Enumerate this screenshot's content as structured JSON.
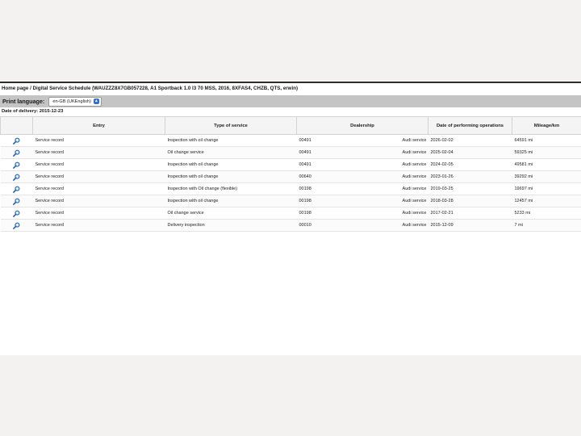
{
  "breadcrumb": {
    "home": "Home page",
    "sep": " / ",
    "current": "Digital Service Schedule (WAUZZZ8X7GB057228, A1 Sportback 1.0 l3 70 MSS, 2016, 8XFAS4, CHZB, QTS, erwin)"
  },
  "print": {
    "label": "Print language:",
    "selected": "en-GB (UKEnglish)"
  },
  "delivery": {
    "text": "Date of delivery: 2015-12-23"
  },
  "table": {
    "headers": [
      "Entry",
      "Type of service",
      "Dealership",
      "Date of performing operations",
      "Mileage/km"
    ],
    "rows": [
      {
        "entry": "Service record",
        "type": "Inspection with oil change",
        "code": "00491",
        "dealer": "Audi service",
        "date": "2026-02-02",
        "mileage": "64591 mi"
      },
      {
        "entry": "Service record",
        "type": "Oil change service",
        "code": "00491",
        "dealer": "Audi service",
        "date": "2025-02-04",
        "mileage": "59325 mi"
      },
      {
        "entry": "Service record",
        "type": "Inspection with oil change",
        "code": "00491",
        "dealer": "Audi service",
        "date": "2024-02-05",
        "mileage": "49581 mi"
      },
      {
        "entry": "Service record",
        "type": "Inspection with oil change",
        "code": "00640",
        "dealer": "Audi service",
        "date": "2023-01-26",
        "mileage": "39292 mi"
      },
      {
        "entry": "Service record",
        "type": "Inspection with Oil change (flexible)",
        "code": "00198",
        "dealer": "Audi service",
        "date": "2019-03-25",
        "mileage": "19697 mi"
      },
      {
        "entry": "Service record",
        "type": "Inspection with oil change",
        "code": "00198",
        "dealer": "Audi service",
        "date": "2018-03-28",
        "mileage": "12457 mi"
      },
      {
        "entry": "Service record",
        "type": "Oil change service",
        "code": "00198",
        "dealer": "Audi service",
        "date": "2017-02-21",
        "mileage": "5233 mi"
      },
      {
        "entry": "Service record",
        "type": "Delivery inspection",
        "code": "00010",
        "dealer": "Audi service",
        "date": "2015-12-09",
        "mileage": "7 mi"
      }
    ]
  },
  "icons": {
    "view": "magnifier-icon",
    "select_arrow": "select-arrow-icon"
  },
  "colors": {
    "print_bar": "#c4c4c4",
    "icon_blue": "#1e63b8",
    "select_arrow": "#2f6fd6"
  }
}
